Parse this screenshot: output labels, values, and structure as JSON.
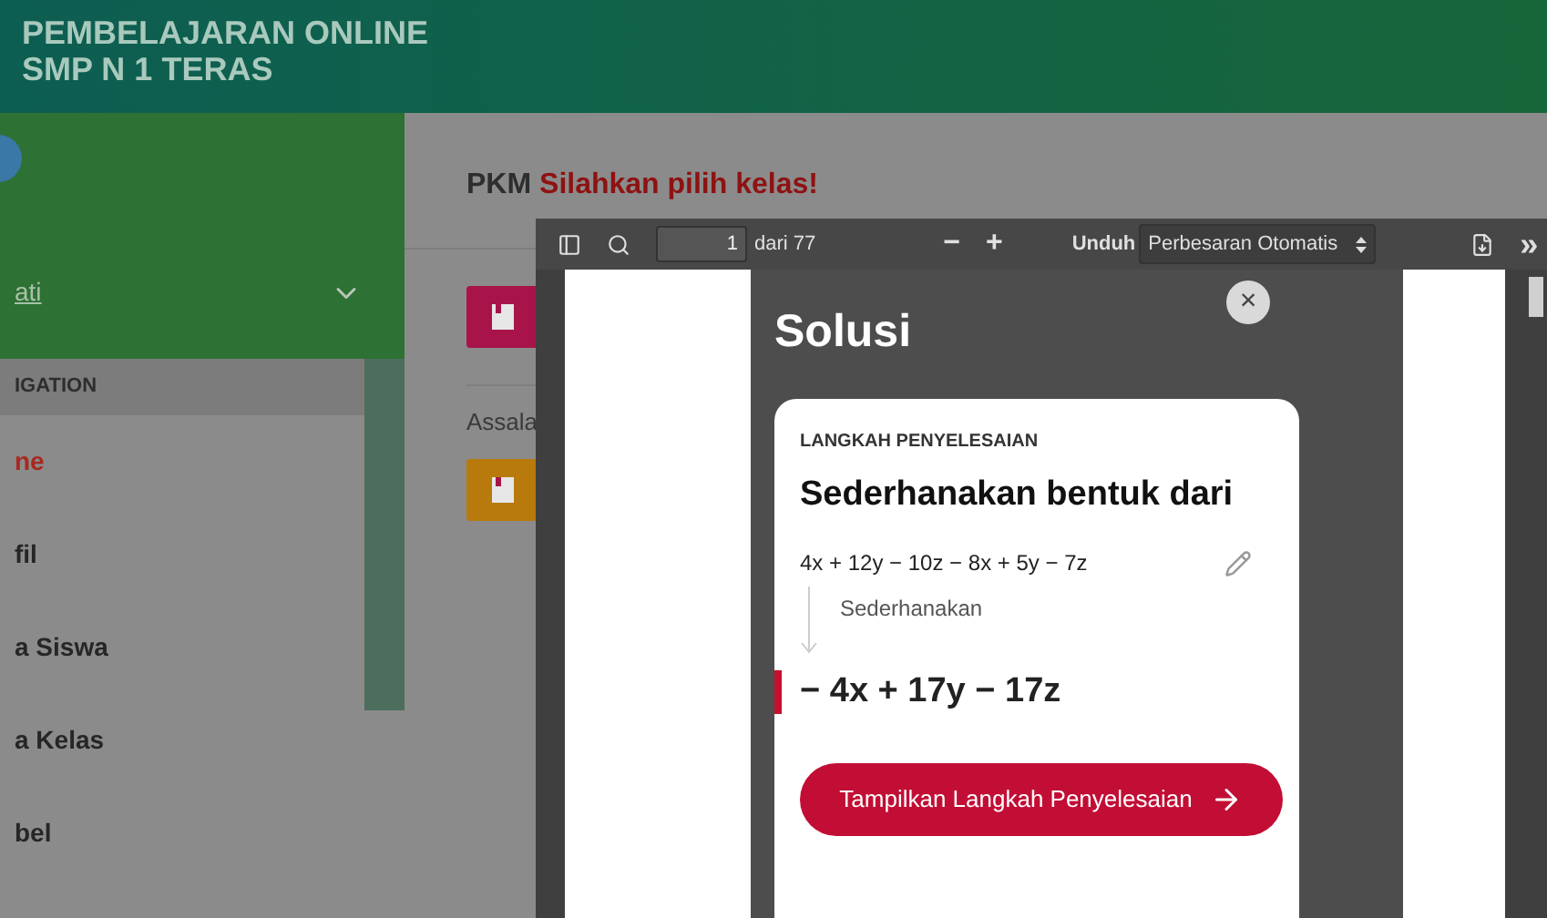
{
  "header": {
    "title_lines": [
      "PEMBELAJARAN ONLINE",
      "SMP N 1 TERAS"
    ]
  },
  "sidebar": {
    "user_link": "ati",
    "nav_heading": "IGATION",
    "items": [
      {
        "label": "ne",
        "selected": true
      },
      {
        "label": "fil",
        "selected": false
      },
      {
        "label": "a Siswa",
        "selected": false
      },
      {
        "label": "a Kelas",
        "selected": false
      },
      {
        "label": "bel",
        "selected": false
      }
    ]
  },
  "content": {
    "title_prefix": "PKM",
    "title_highlight": "Silahkan pilih kelas!",
    "greeting": "Assala",
    "buttons": [
      {
        "color": "#a8144a"
      },
      {
        "color": "#b87a0c"
      }
    ]
  },
  "pdf_viewer": {
    "page_number": "1",
    "page_count": "dari 77",
    "zoom_out": "−",
    "zoom_in": "+",
    "download": "Unduh",
    "zoom_select": "Perbesaran Otomatis",
    "more": "»"
  },
  "solution": {
    "title": "Solusi",
    "close": "×",
    "step_label": "LANGKAH PENYELESAIAN",
    "heading": "Sederhanakan bentuk dari",
    "expression": "4x + 12y − 10z − 8x + 5y − 7z",
    "step_name": "Sederhanakan",
    "result": "− 4x + 17y − 17z",
    "action": "Tampilkan Langkah Penyelesaian"
  }
}
